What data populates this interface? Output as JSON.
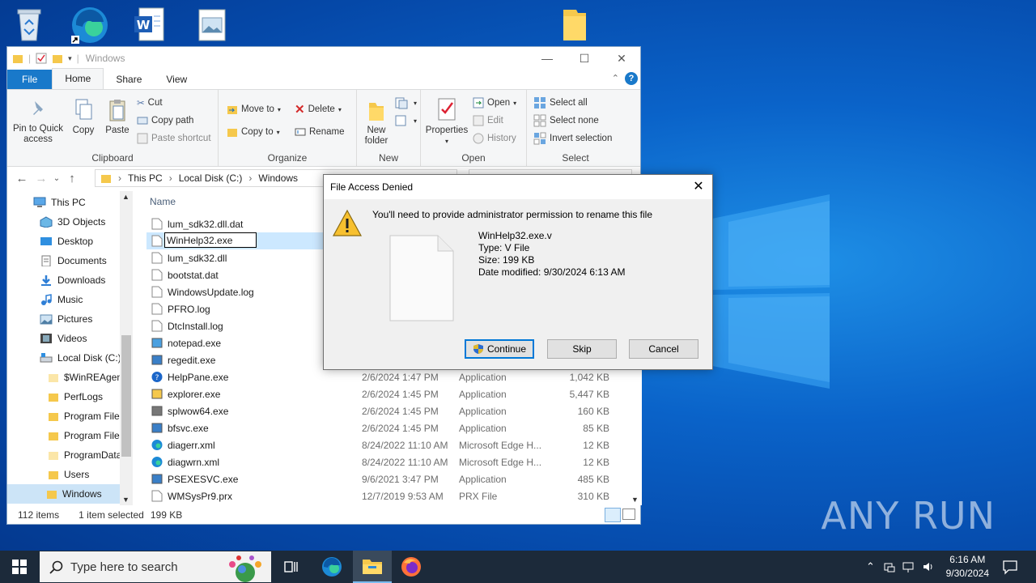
{
  "explorer": {
    "title": "Windows",
    "tabs": [
      "File",
      "Home",
      "Share",
      "View"
    ],
    "ribbon": {
      "clipboard": {
        "pin_label": "Pin to Quick access",
        "copy_label": "Copy",
        "paste_label": "Paste",
        "cut_label": "Cut",
        "copy_path_label": "Copy path",
        "paste_shortcut_label": "Paste shortcut",
        "group_label": "Clipboard"
      },
      "organize": {
        "move_to_label": "Move to",
        "copy_to_label": "Copy to",
        "delete_label": "Delete",
        "rename_label": "Rename",
        "group_label": "Organize"
      },
      "new": {
        "new_folder_label": "New folder",
        "group_label": "New"
      },
      "open": {
        "properties_label": "Properties",
        "open_label": "Open",
        "edit_label": "Edit",
        "history_label": "History",
        "group_label": "Open"
      },
      "select": {
        "select_all_label": "Select all",
        "select_none_label": "Select none",
        "invert_label": "Invert selection",
        "group_label": "Select"
      }
    },
    "breadcrumb": [
      "This PC",
      "Local Disk (C:)",
      "Windows"
    ],
    "nav_items": [
      "This PC",
      "3D Objects",
      "Desktop",
      "Documents",
      "Downloads",
      "Music",
      "Pictures",
      "Videos",
      "Local Disk (C:)",
      "$WinREAgent",
      "PerfLogs",
      "Program Files",
      "Program Files",
      "ProgramData",
      "Users",
      "Windows"
    ],
    "column_name": "Name",
    "files": [
      {
        "name": "lum_sdk32.dll.dat",
        "date": "",
        "type": "",
        "size": ""
      },
      {
        "name": "WinHelp32.exe",
        "date": "",
        "type": "",
        "size": ""
      },
      {
        "name": "lum_sdk32.dll",
        "date": "",
        "type": "",
        "size": ""
      },
      {
        "name": "bootstat.dat",
        "date": "",
        "type": "",
        "size": ""
      },
      {
        "name": "WindowsUpdate.log",
        "date": "",
        "type": "",
        "size": ""
      },
      {
        "name": "PFRO.log",
        "date": "",
        "type": "",
        "size": ""
      },
      {
        "name": "DtcInstall.log",
        "date": "",
        "type": "",
        "size": ""
      },
      {
        "name": "notepad.exe",
        "date": "",
        "type": "",
        "size": ""
      },
      {
        "name": "regedit.exe",
        "date": "",
        "type": "",
        "size": ""
      },
      {
        "name": "HelpPane.exe",
        "date": "2/6/2024 1:47 PM",
        "type": "Application",
        "size": "1,042 KB"
      },
      {
        "name": "explorer.exe",
        "date": "2/6/2024 1:45 PM",
        "type": "Application",
        "size": "5,447 KB"
      },
      {
        "name": "splwow64.exe",
        "date": "2/6/2024 1:45 PM",
        "type": "Application",
        "size": "160 KB"
      },
      {
        "name": "bfsvc.exe",
        "date": "2/6/2024 1:45 PM",
        "type": "Application",
        "size": "85 KB"
      },
      {
        "name": "diagerr.xml",
        "date": "8/24/2022 11:10 AM",
        "type": "Microsoft Edge H...",
        "size": "12 KB"
      },
      {
        "name": "diagwrn.xml",
        "date": "8/24/2022 11:10 AM",
        "type": "Microsoft Edge H...",
        "size": "12 KB"
      },
      {
        "name": "PSEXESVC.exe",
        "date": "9/6/2021 3:47 PM",
        "type": "Application",
        "size": "485 KB"
      },
      {
        "name": "WMSysPr9.prx",
        "date": "12/7/2019 9:53 AM",
        "type": "PRX File",
        "size": "310 KB"
      }
    ],
    "rename_value": "WinHelp32.exe",
    "status": {
      "items": "112 items",
      "selected": "1 item selected",
      "size": "199 KB"
    }
  },
  "dialog": {
    "title": "File Access Denied",
    "message": "You'll need to provide administrator permission to rename this file",
    "file_name": "WinHelp32.exe.v",
    "file_type": "Type: V File",
    "file_size": "Size: 199 KB",
    "file_modified": "Date modified: 9/30/2024 6:13 AM",
    "continue_label": "Continue",
    "skip_label": "Skip",
    "cancel_label": "Cancel"
  },
  "taskbar": {
    "search_placeholder": "Type here to search",
    "time": "6:16 AM",
    "date": "9/30/2024"
  },
  "watermark": "ANY RUN"
}
